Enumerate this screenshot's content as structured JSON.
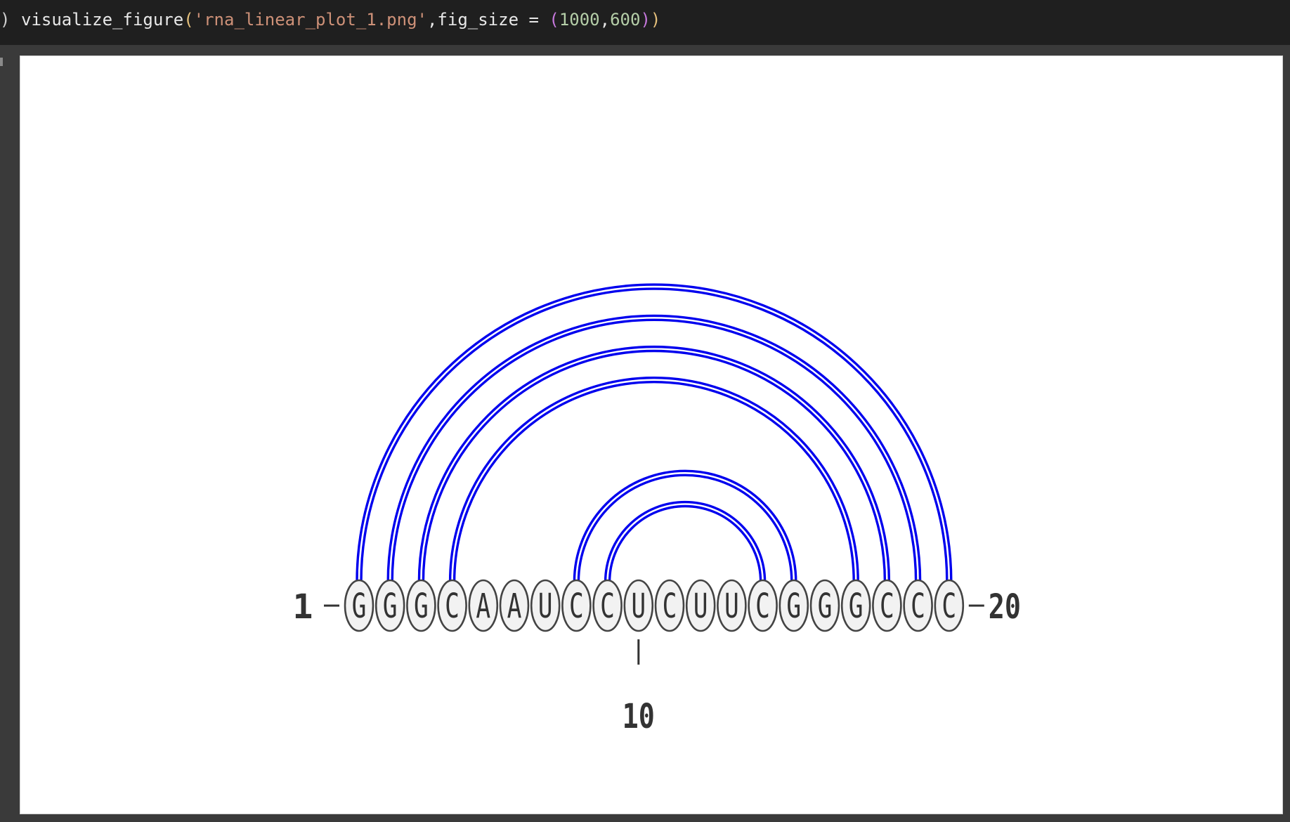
{
  "cell": {
    "prompt": ")",
    "code": {
      "fn": "visualize_figure",
      "open_paren": "(",
      "filename": "'rna_linear_plot_1.png'",
      "sep": ",fig_size = ",
      "tuple_open": "(",
      "width": "1000",
      "comma": ",",
      "height": "600",
      "tuple_close": ")",
      "close_paren": ")"
    }
  },
  "colors": {
    "arc": "#0000ee",
    "nucleotide_fill": "#f2f2f2",
    "nucleotide_stroke": "#444444",
    "text": "#333333"
  },
  "chart_data": {
    "type": "arc-diagram",
    "sequence": [
      "G",
      "G",
      "G",
      "C",
      "A",
      "A",
      "U",
      "C",
      "C",
      "U",
      "C",
      "U",
      "U",
      "C",
      "G",
      "G",
      "G",
      "C",
      "C",
      "C"
    ],
    "pairs": [
      [
        1,
        20
      ],
      [
        2,
        19
      ],
      [
        3,
        18
      ],
      [
        4,
        17
      ],
      [
        8,
        15
      ],
      [
        9,
        14
      ]
    ],
    "start_label": "1",
    "end_label": "20",
    "tick_positions": [
      10
    ],
    "tick_labels": [
      "10"
    ]
  }
}
